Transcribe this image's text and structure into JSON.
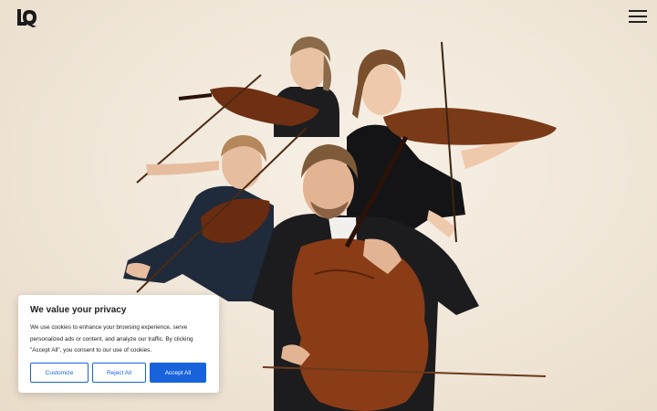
{
  "header": {
    "logo_icon": "lq-monogram-logo",
    "menu_icon": "hamburger-menu-icon"
  },
  "hero": {
    "image": "string-quartet-photo",
    "colors": {
      "background": "#f3ebdf",
      "dark": "#1c1c1e",
      "wood": "#7a3a18"
    }
  },
  "cookie_banner": {
    "title": "We value your privacy",
    "text": "We use cookies to enhance your browsing experience, serve personalized ads or content, and analyze our traffic. By clicking \"Accept All\", you consent to our use of cookies.",
    "buttons": {
      "customize": "Customize",
      "reject": "Reject All",
      "accept": "Accept All"
    },
    "accent_color": "#1863dc"
  }
}
